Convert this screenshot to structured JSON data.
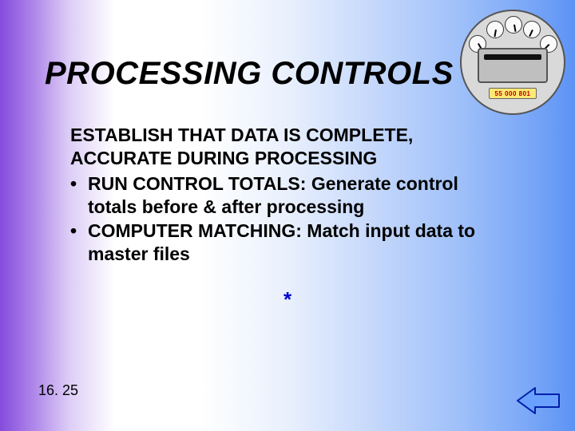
{
  "title": "PROCESSING CONTROLS",
  "intro_line1": "ESTABLISH THAT DATA IS COMPLETE,",
  "intro_line2": "ACCURATE DURING PROCESSING",
  "bullets": [
    {
      "term": "RUN CONTROL TOTALS:",
      "rest": " Generate control totals before & after processing"
    },
    {
      "term": "COMPUTER MATCHING:",
      "rest": " Match input data to master files"
    }
  ],
  "asterisk": "*",
  "page_number": "16. 25",
  "meter_readout": "55 000 801"
}
